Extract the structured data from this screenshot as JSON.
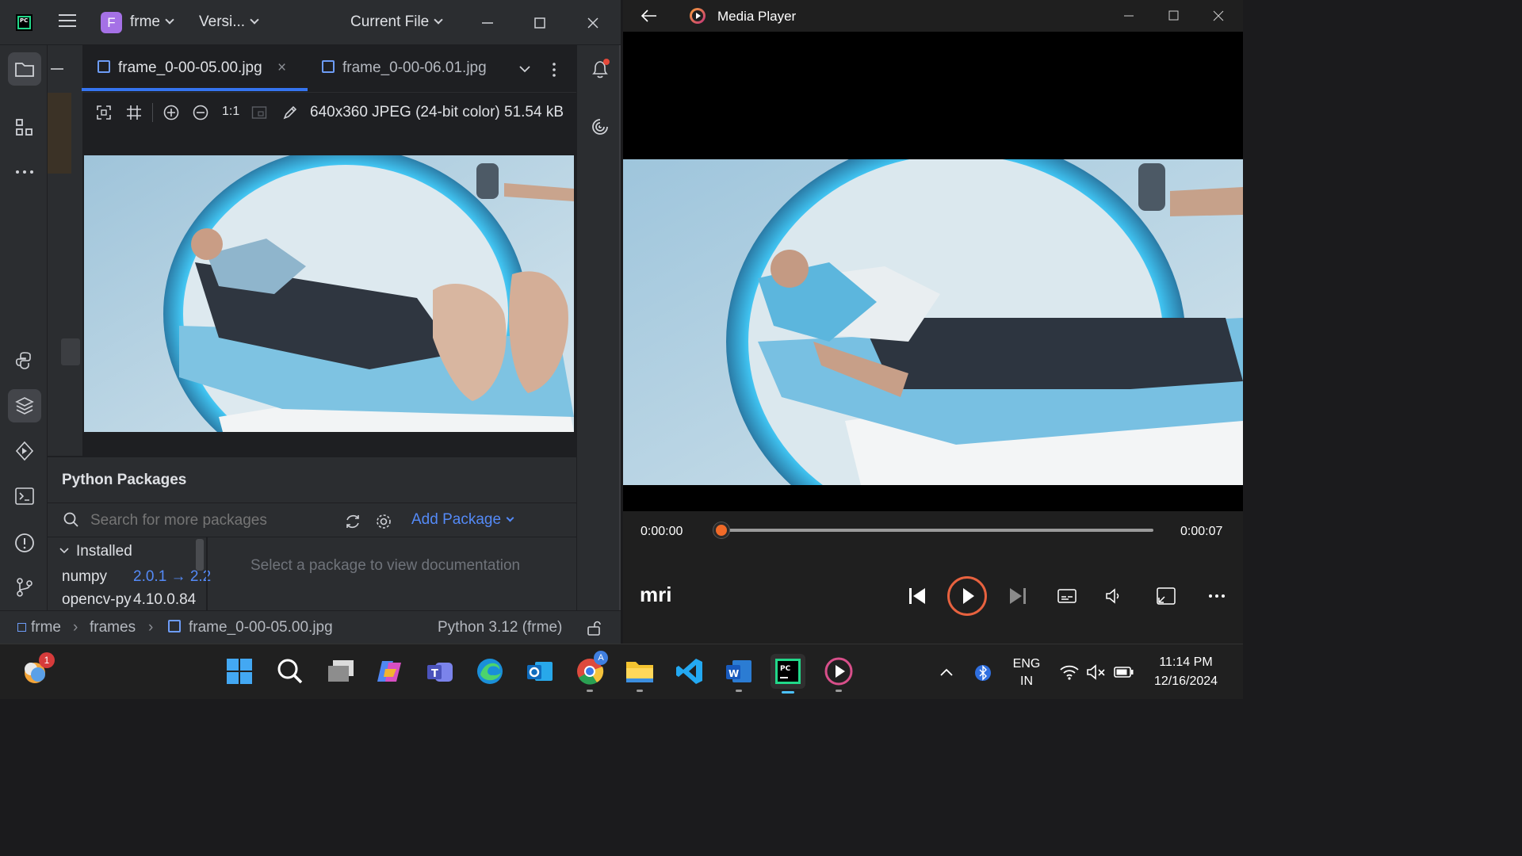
{
  "ide": {
    "project_badge": "F",
    "project_name": "frme",
    "vcs_label": "Versi...",
    "run_config": "Current File",
    "tabs": [
      {
        "label": "frame_0-00-05.00.jpg",
        "active": true
      },
      {
        "label": "frame_0-00-06.01.jpg",
        "active": false
      }
    ],
    "toolbar": {
      "zoom_actual": "1:1",
      "image_info": "640x360 JPEG (24-bit color) 51.54 kB"
    },
    "packages": {
      "title": "Python Packages",
      "search_placeholder": "Search for more packages",
      "add_package": "Add Package",
      "installed_label": "Installed",
      "rows": [
        {
          "name": "numpy",
          "version": "2.0.1 → 2.2"
        },
        {
          "name": "opencv-py",
          "version": "4.10.0.84"
        }
      ],
      "doc_hint": "Select a package to view documentation"
    },
    "statusbar": {
      "crumb_project": "frme",
      "crumb_folder": "frames",
      "crumb_file": "frame_0-00-05.00.jpg",
      "interpreter": "Python 3.12 (frme)"
    }
  },
  "player": {
    "title": "Media Player",
    "time_current": "0:00:00",
    "time_total": "0:00:07",
    "progress": 0.0,
    "media_name": "mri"
  },
  "taskbar": {
    "notification_badge": "1",
    "chrome_profile_badge": "A",
    "language_line1": "ENG",
    "language_line2": "IN",
    "time": "11:14 PM",
    "date": "12/16/2024"
  },
  "colors": {
    "ide_bg": "#1e1f22",
    "ide_panel": "#2b2d30",
    "accent_blue": "#3574f0",
    "link_blue": "#548af7",
    "player_accent": "#f06a28",
    "pycharm_green": "#21d789"
  }
}
